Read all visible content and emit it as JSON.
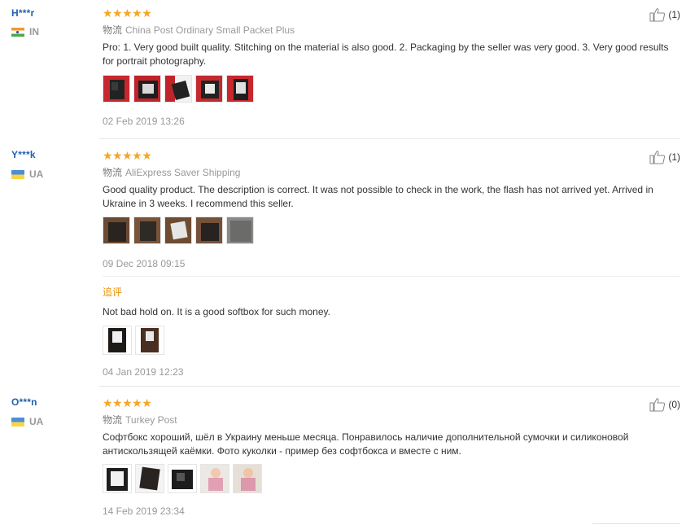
{
  "reviews": [
    {
      "user": "H***r",
      "country": "IN",
      "stars": "★★★★★",
      "shipping_label": "物流",
      "shipping": "China Post Ordinary Small Packet Plus",
      "text": "Pro: 1. Very good built quality. Stitching on the material is also good. 2. Packaging by the seller was very good. 3. Very good results for portrait photography.",
      "date": "02 Feb 2019 13:26",
      "helpful_count": "(1)"
    },
    {
      "user": "Y***k",
      "country": "UA",
      "stars": "★★★★★",
      "shipping_label": "物流",
      "shipping": "AliExpress Saver Shipping",
      "text": "Good quality product. The description is correct. It was not possible to check in the work, the flash has not arrived yet. Arrived in Ukraine in 3 weeks. I recommend this seller.",
      "date": "09 Dec 2018 09:15",
      "helpful_count": "(1)",
      "followup_label": "追评",
      "followup_text": "Not bad hold on. It is a good softbox for such money.",
      "followup_date": "04 Jan 2019 12:23"
    },
    {
      "user": "O***n",
      "country": "UA",
      "stars": "★★★★★",
      "shipping_label": "物流",
      "shipping": "Turkey Post",
      "text": "Софтбокс хороший, шёл в Украину меньше месяца. Понравилось наличие дополнительной сумочки и силиконовой антискользящей каёмки. Фото куколки - пример без софтбокса и вместе с ним.",
      "date": "14 Feb 2019 23:34",
      "helpful_count": "(0)"
    }
  ],
  "colors": {
    "user_link": "#2361b3",
    "star": "#f5a623",
    "followup": "#e8900b",
    "muted": "#999999"
  },
  "icons": {
    "helpful": "thumbs-up-icon"
  }
}
